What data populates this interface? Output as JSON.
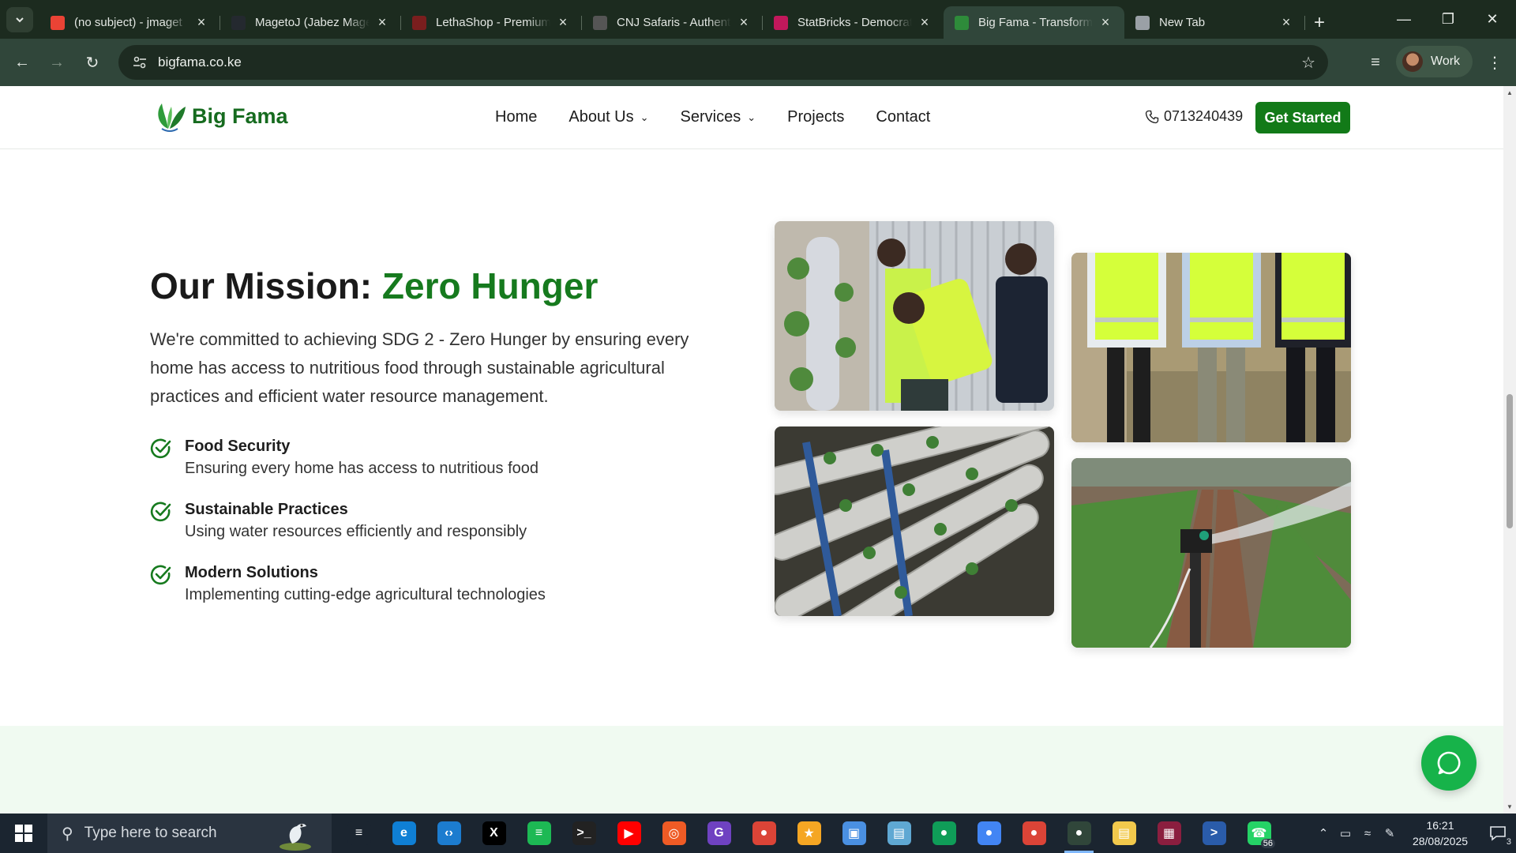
{
  "browser": {
    "tabs": [
      {
        "title": "(no subject) - jmaget",
        "favicon": "gmail-icon",
        "color": "#ea4335"
      },
      {
        "title": "MagetoJ (Jabez Mageto)",
        "favicon": "github-icon",
        "color": "#24292f"
      },
      {
        "title": "LethaShop - Premium",
        "favicon": "lethashop-icon",
        "color": "#7a1e1e"
      },
      {
        "title": "CNJ Safaris - Authentic",
        "favicon": "cnj-safaris-icon",
        "color": "#555555"
      },
      {
        "title": "StatBricks - Democratizing",
        "favicon": "statbricks-icon",
        "color": "#c2185b"
      },
      {
        "title": "Big Fama - Transforming",
        "favicon": "bigfama-leaf-icon",
        "color": "#2e8b3a",
        "active": true
      },
      {
        "title": "New Tab",
        "favicon": "chrome-icon",
        "color": "#9aa0a6"
      }
    ],
    "url": "bigfama.co.ke",
    "profile": "Work"
  },
  "site": {
    "brand": "Big Fama",
    "nav": [
      {
        "label": "Home",
        "dropdown": false
      },
      {
        "label": "About Us",
        "dropdown": true
      },
      {
        "label": "Services",
        "dropdown": true
      },
      {
        "label": "Projects",
        "dropdown": false
      },
      {
        "label": "Contact",
        "dropdown": false
      }
    ],
    "phone": "0713240439",
    "cta": "Get Started",
    "accent_color": "#167a1e"
  },
  "mission": {
    "title_prefix": "Our Mission: ",
    "title_accent": "Zero Hunger",
    "lead": "We're committed to achieving SDG 2 - Zero Hunger by ensuring every home has access to nutritious food through sustainable agricultural practices and efficient water resource management.",
    "features": [
      {
        "title": "Food Security",
        "desc": "Ensuring every home has access to nutritious food"
      },
      {
        "title": "Sustainable Practices",
        "desc": "Using water resources efficiently and responsibly"
      },
      {
        "title": "Modern Solutions",
        "desc": "Implementing cutting-edge agricultural technologies"
      }
    ]
  },
  "taskbar": {
    "search_placeholder": "Type here to search",
    "time": "16:21",
    "date": "28/08/2025",
    "whatsapp_badge": "56",
    "notification_count": "3"
  }
}
